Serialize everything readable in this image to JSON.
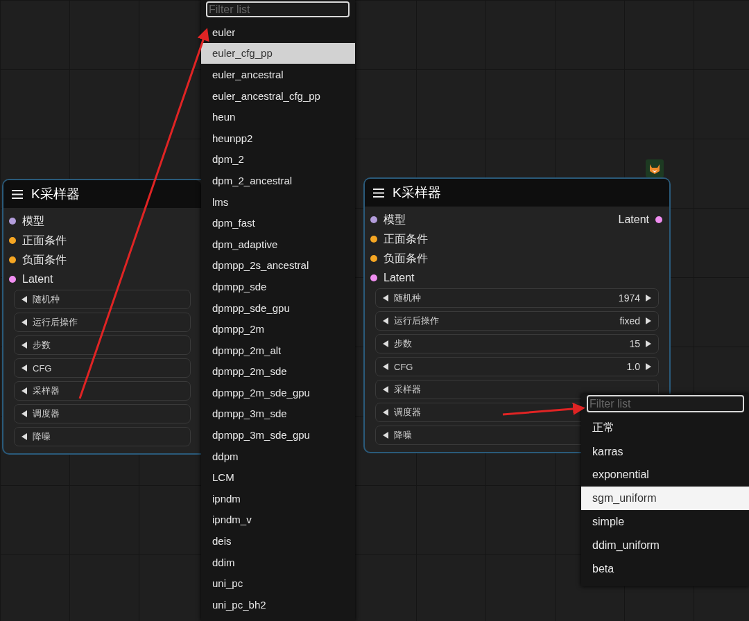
{
  "nodes": [
    {
      "title": "K采样器",
      "inputs": [
        {
          "label": "模型",
          "color": "#b39ddb"
        },
        {
          "label": "正面条件",
          "color": "#f5a623"
        },
        {
          "label": "负面条件",
          "color": "#f5a623"
        },
        {
          "label": "Latent",
          "color": "#f08ef0"
        }
      ],
      "widgets": [
        {
          "label": "随机种"
        },
        {
          "label": "运行后操作"
        },
        {
          "label": "步数"
        },
        {
          "label": "CFG"
        },
        {
          "label": "采样器"
        },
        {
          "label": "调度器"
        },
        {
          "label": "降噪"
        }
      ]
    },
    {
      "title": "K采样器",
      "inputs": [
        {
          "label": "模型",
          "color": "#b39ddb"
        },
        {
          "label": "正面条件",
          "color": "#f5a623"
        },
        {
          "label": "负面条件",
          "color": "#f5a623"
        },
        {
          "label": "Latent",
          "color": "#f08ef0"
        }
      ],
      "outputs": [
        {
          "label": "Latent",
          "color": "#f08ef0"
        }
      ],
      "widgets": [
        {
          "label": "随机种",
          "value": "1974"
        },
        {
          "label": "运行后操作",
          "value": "fixed"
        },
        {
          "label": "步数",
          "value": "15"
        },
        {
          "label": "CFG",
          "value": "1.0"
        },
        {
          "label": "采样器"
        },
        {
          "label": "调度器"
        },
        {
          "label": "降噪"
        }
      ]
    }
  ],
  "menus": [
    {
      "placeholder": "Filter list",
      "items": [
        {
          "label": "euler",
          "selected": false
        },
        {
          "label": "euler_cfg_pp",
          "selected": true
        },
        {
          "label": "euler_ancestral",
          "selected": false
        },
        {
          "label": "euler_ancestral_cfg_pp",
          "selected": false
        },
        {
          "label": "heun",
          "selected": false
        },
        {
          "label": "heunpp2",
          "selected": false
        },
        {
          "label": "dpm_2",
          "selected": false
        },
        {
          "label": "dpm_2_ancestral",
          "selected": false
        },
        {
          "label": "lms",
          "selected": false
        },
        {
          "label": "dpm_fast",
          "selected": false
        },
        {
          "label": "dpm_adaptive",
          "selected": false
        },
        {
          "label": "dpmpp_2s_ancestral",
          "selected": false
        },
        {
          "label": "dpmpp_sde",
          "selected": false
        },
        {
          "label": "dpmpp_sde_gpu",
          "selected": false
        },
        {
          "label": "dpmpp_2m",
          "selected": false
        },
        {
          "label": "dpmpp_2m_alt",
          "selected": false
        },
        {
          "label": "dpmpp_2m_sde",
          "selected": false
        },
        {
          "label": "dpmpp_2m_sde_gpu",
          "selected": false
        },
        {
          "label": "dpmpp_3m_sde",
          "selected": false
        },
        {
          "label": "dpmpp_3m_sde_gpu",
          "selected": false
        },
        {
          "label": "ddpm",
          "selected": false
        },
        {
          "label": "LCM",
          "selected": false
        },
        {
          "label": "ipndm",
          "selected": false
        },
        {
          "label": "ipndm_v",
          "selected": false
        },
        {
          "label": "deis",
          "selected": false
        },
        {
          "label": "ddim",
          "selected": false
        },
        {
          "label": "uni_pc",
          "selected": false
        },
        {
          "label": "uni_pc_bh2",
          "selected": false
        }
      ]
    },
    {
      "placeholder": "Filter list",
      "items": [
        {
          "label": "正常",
          "selected": false
        },
        {
          "label": "karras",
          "selected": false
        },
        {
          "label": "exponential",
          "selected": false
        },
        {
          "label": "sgm_uniform",
          "selected": true
        },
        {
          "label": "simple",
          "selected": false
        },
        {
          "label": "ddim_uniform",
          "selected": false
        },
        {
          "label": "beta",
          "selected": false
        }
      ]
    }
  ]
}
